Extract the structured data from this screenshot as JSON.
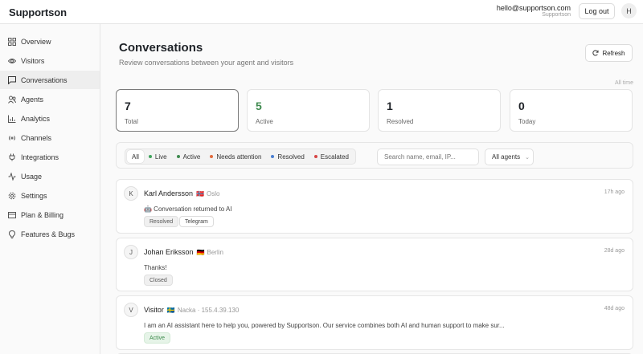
{
  "app": {
    "brand": "Supportson",
    "user_email": "hello@supportson.com",
    "user_org": "Supportson",
    "logout_label": "Log out",
    "avatar_initial": "H"
  },
  "sidebar": {
    "items": [
      {
        "label": "Overview",
        "icon": "grid-icon"
      },
      {
        "label": "Visitors",
        "icon": "eye-icon"
      },
      {
        "label": "Conversations",
        "icon": "chat-icon",
        "active": true
      },
      {
        "label": "Agents",
        "icon": "users-icon"
      },
      {
        "label": "Analytics",
        "icon": "bar-chart-icon"
      },
      {
        "label": "Channels",
        "icon": "broadcast-icon"
      },
      {
        "label": "Integrations",
        "icon": "plug-icon"
      },
      {
        "label": "Usage",
        "icon": "activity-icon"
      },
      {
        "label": "Settings",
        "icon": "gear-icon"
      },
      {
        "label": "Plan & Billing",
        "icon": "credit-card-icon"
      },
      {
        "label": "Features & Bugs",
        "icon": "lightbulb-icon"
      }
    ]
  },
  "page": {
    "title": "Conversations",
    "subtitle": "Review conversations between your agent and visitors",
    "refresh_label": "Refresh",
    "time_range": "All time"
  },
  "stats": [
    {
      "value": "7",
      "label": "Total",
      "selected": true
    },
    {
      "value": "5",
      "label": "Active",
      "color": "#3f8a4f"
    },
    {
      "value": "1",
      "label": "Resolved"
    },
    {
      "value": "0",
      "label": "Today"
    }
  ],
  "filters": {
    "chips": [
      {
        "label": "All",
        "active": true
      },
      {
        "label": "Live",
        "dot": "#3fa35b"
      },
      {
        "label": "Active",
        "dot": "#3f8a4f"
      },
      {
        "label": "Needs attention",
        "dot": "#e06a3c"
      },
      {
        "label": "Resolved",
        "dot": "#4a7fd1"
      },
      {
        "label": "Escalated",
        "dot": "#d64545"
      }
    ],
    "search_placeholder": "Search name, email, IP...",
    "agents_select": "All agents"
  },
  "conversations": [
    {
      "initial": "K",
      "name": "Karl Andersson",
      "flag": "🇳🇴",
      "location": "Oslo",
      "time": "17h ago",
      "message": "🤖 Conversation returned to AI",
      "tags": [
        {
          "label": "Resolved",
          "style": "gray"
        },
        {
          "label": "Telegram",
          "style": "outline"
        }
      ]
    },
    {
      "initial": "J",
      "name": "Johan Eriksson",
      "flag": "🇩🇪",
      "location": "Berlin",
      "time": "28d ago",
      "message": "Thanks!",
      "tags": [
        {
          "label": "Closed",
          "style": "gray"
        }
      ]
    },
    {
      "initial": "V",
      "name": "Visitor",
      "flag": "🇸🇪",
      "location": "Nacka · 155.4.39.130",
      "time": "48d ago",
      "message": "I am an AI assistant here to help you, powered by Supportson. Our service combines both AI and human support to make sur...",
      "tags": [
        {
          "label": "Active",
          "style": "green"
        }
      ]
    }
  ]
}
